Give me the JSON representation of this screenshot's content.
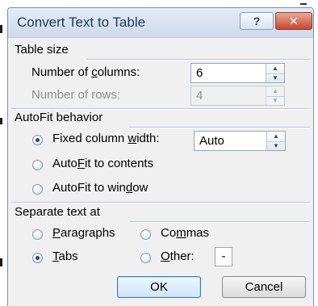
{
  "window": {
    "title": "Convert Text to Table",
    "help_glyph": "?",
    "close_glyph": "✕"
  },
  "table_size": {
    "heading": "Table size",
    "columns": {
      "label_pre": "Number of ",
      "label_key": "c",
      "label_post": "olumns:",
      "value": "6",
      "enabled": true
    },
    "rows": {
      "label": "Number of rows:",
      "value": "4",
      "enabled": false
    }
  },
  "autofit": {
    "heading": "AutoFit behavior",
    "options": [
      {
        "id": "fixed",
        "pre": "Fixed column ",
        "key": "w",
        "post": "idth:",
        "checked": true
      },
      {
        "id": "contents",
        "pre": "Auto",
        "key": "F",
        "post": "it to contents",
        "checked": false
      },
      {
        "id": "window",
        "pre": "AutoFit to win",
        "key": "d",
        "post": "ow",
        "checked": false
      }
    ],
    "fixed_width_value": "Auto"
  },
  "separate": {
    "heading": "Separate text at",
    "options": [
      {
        "id": "paragraphs",
        "pre": "",
        "key": "P",
        "post": "aragraphs",
        "checked": false
      },
      {
        "id": "commas",
        "pre": "Co",
        "key": "m",
        "post": "mas",
        "checked": false
      },
      {
        "id": "tabs",
        "pre": "",
        "key": "T",
        "post": "abs",
        "checked": true
      },
      {
        "id": "other",
        "pre": "",
        "key": "O",
        "post": "ther:",
        "checked": false
      }
    ],
    "other_value": "-"
  },
  "buttons": {
    "ok": "OK",
    "cancel": "Cancel"
  },
  "colors": {
    "title_text": "#1e395b",
    "dialog_bg": "#f0f0f0",
    "close_button": "#c8462e",
    "default_button_border": "#3c7fb1"
  },
  "icons": [
    "help-icon",
    "close-icon",
    "spin-up-icon",
    "spin-down-icon"
  ]
}
